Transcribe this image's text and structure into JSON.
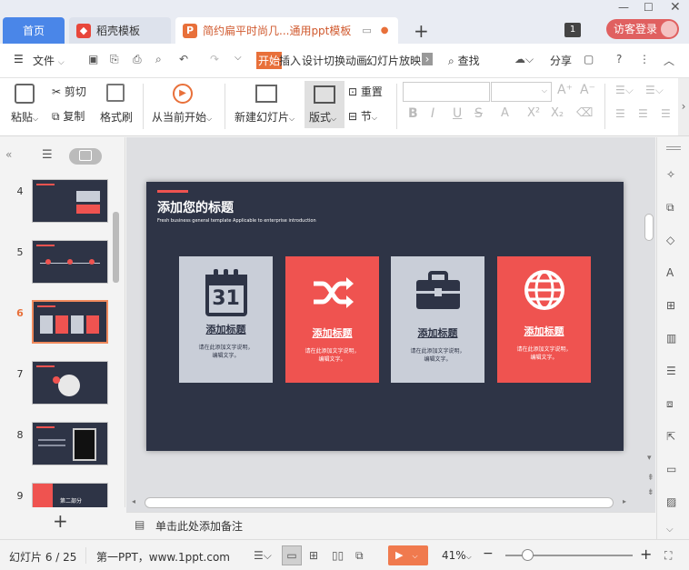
{
  "tabs": {
    "home": "首页",
    "daoke": "稻壳模板",
    "doc": "简约扁平时尚几...通用ppt模板",
    "page_badge": "1",
    "guest_login": "访客登录"
  },
  "menu": {
    "file": "文件",
    "items": [
      "开始",
      "插入",
      "设计",
      "切换",
      "动画",
      "幻灯片放映"
    ],
    "search": "查找",
    "share": "分享"
  },
  "ribbon": {
    "paste": "粘贴",
    "cut": "剪切",
    "copy": "复制",
    "format_painter": "格式刷",
    "from_current": "从当前开始",
    "new_slide": "新建幻灯片",
    "layout": "版式",
    "reset": "重置",
    "section": "节"
  },
  "thumbs": [
    {
      "n": "4"
    },
    {
      "n": "5"
    },
    {
      "n": "6"
    },
    {
      "n": "7"
    },
    {
      "n": "8"
    },
    {
      "n": "9",
      "text": "第二部分"
    }
  ],
  "slide": {
    "title": "添加您的标题",
    "subtitle": "Fresh business general template Applicable to enterprise introduction",
    "cards": [
      {
        "icon": "calendar-icon",
        "glyph": "31",
        "title": "添加标题",
        "desc1": "请在此添加文字说明，",
        "desc2": "编辑文字。",
        "bg": "#c9ced8",
        "fg": "#2e3446"
      },
      {
        "icon": "shuffle-icon",
        "title": "添加标题",
        "desc1": "请在此添加文字说明，",
        "desc2": "编辑文字。",
        "bg": "#ef5350",
        "fg": "#ffffff"
      },
      {
        "icon": "briefcase-icon",
        "title": "添加标题",
        "desc1": "请在此添加文字说明，",
        "desc2": "编辑文字。",
        "bg": "#c9ced8",
        "fg": "#2e3446"
      },
      {
        "icon": "globe-icon",
        "title": "添加标题",
        "desc1": "请在此添加文字说明，",
        "desc2": "编辑文字。",
        "bg": "#ef5350",
        "fg": "#ffffff"
      }
    ]
  },
  "notes": {
    "placeholder": "单击此处添加备注"
  },
  "status": {
    "slide_count": "幻灯片 6 / 25",
    "theme": "第一PPT，www.1ppt.com",
    "zoom": "41%"
  },
  "colors": {
    "accent": "#e8703a",
    "blue": "#4a86e8",
    "slide_bg": "#2e3446",
    "red": "#ef5350"
  }
}
